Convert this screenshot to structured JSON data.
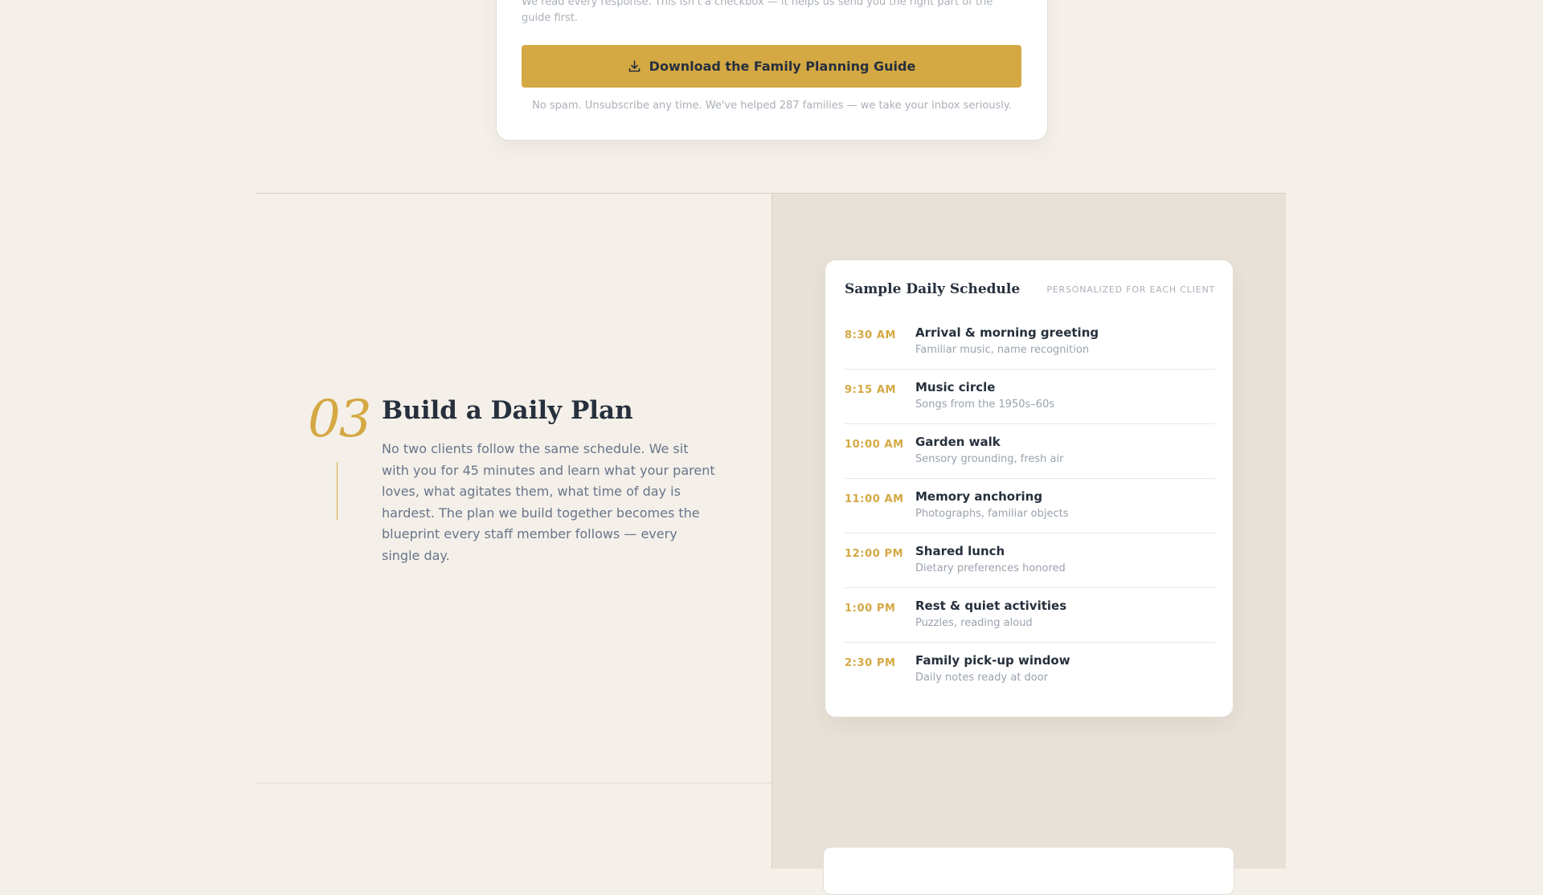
{
  "form": {
    "note": "We read every response. This isn't a checkbox — it helps us send you the right part of the guide first.",
    "button_label": "Download the Family Planning Guide",
    "button_icon": "download-icon",
    "disclaimer": "No spam. Unsubscribe any time. We've helped 287 families — we take your inbox seriously."
  },
  "step": {
    "number": "03",
    "title": "Build a Daily Plan",
    "body": "No two clients follow the same schedule. We sit with you for 45 minutes and learn what your parent loves, what agitates them, what time of day is hardest. The plan we build together becomes the blueprint every staff member follows — every single day."
  },
  "schedule": {
    "title": "Sample Daily Schedule",
    "badge": "PERSONALIZED FOR EACH CLIENT",
    "items": [
      {
        "time": "8:30 AM",
        "activity": "Arrival & morning greeting",
        "detail": "Familiar music, name recognition"
      },
      {
        "time": "9:15 AM",
        "activity": "Music circle",
        "detail": "Songs from the 1950s–60s"
      },
      {
        "time": "10:00 AM",
        "activity": "Garden walk",
        "detail": "Sensory grounding, fresh air"
      },
      {
        "time": "11:00 AM",
        "activity": "Memory anchoring",
        "detail": "Photographs, familiar objects"
      },
      {
        "time": "12:00 PM",
        "activity": "Shared lunch",
        "detail": "Dietary preferences honored"
      },
      {
        "time": "1:00 PM",
        "activity": "Rest & quiet activities",
        "detail": "Puzzles, reading aloud"
      },
      {
        "time": "2:30 PM",
        "activity": "Family pick-up window",
        "detail": "Daily notes ready at door"
      }
    ]
  },
  "colors": {
    "page_background": "#f4f0e9",
    "panel_background": "#e8e1d7",
    "accent_gold": "#d4a843",
    "heading_navy": "#26303d",
    "body_slate": "#68748a"
  }
}
